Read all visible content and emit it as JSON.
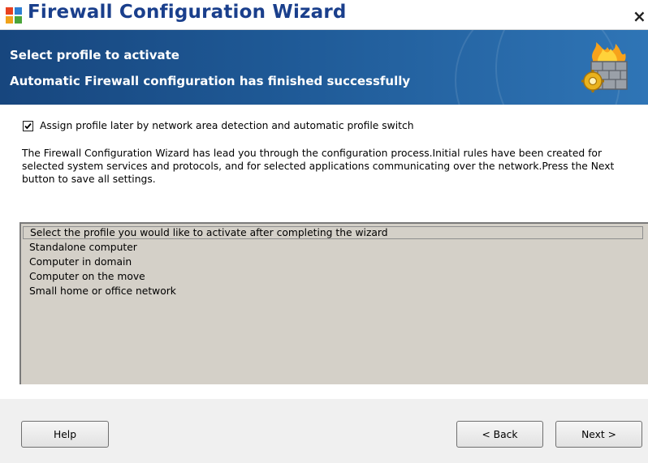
{
  "window": {
    "title": "Firewall Configuration Wizard",
    "close_label": "×"
  },
  "banner": {
    "line1": "Select profile to activate",
    "line2": "Automatic Firewall configuration has finished successfully"
  },
  "options": {
    "assign_later": {
      "label": "Assign profile later by network area detection and automatic profile switch",
      "checked": true
    }
  },
  "description": "The Firewall Configuration Wizard has lead you through the configuration process.Initial rules have been created for selected system services and protocols, and for selected applications communicating over the network.Press the Next button to save all settings.",
  "profile_list": {
    "header": "Select the profile you would like to activate after completing the wizard",
    "items": [
      "Standalone computer",
      "Computer in domain",
      "Computer on the move",
      "Small home or office network"
    ]
  },
  "buttons": {
    "help": "Help",
    "back": "< Back",
    "next": "Next >"
  },
  "colors": {
    "title_text": "#1a3f8c",
    "banner_start": "#17467e",
    "banner_end": "#2f75b6",
    "list_background": "#d4d0c8"
  },
  "icons": {
    "title": "firewall-app-icon",
    "banner": "firewall-wall-gear-icon"
  }
}
